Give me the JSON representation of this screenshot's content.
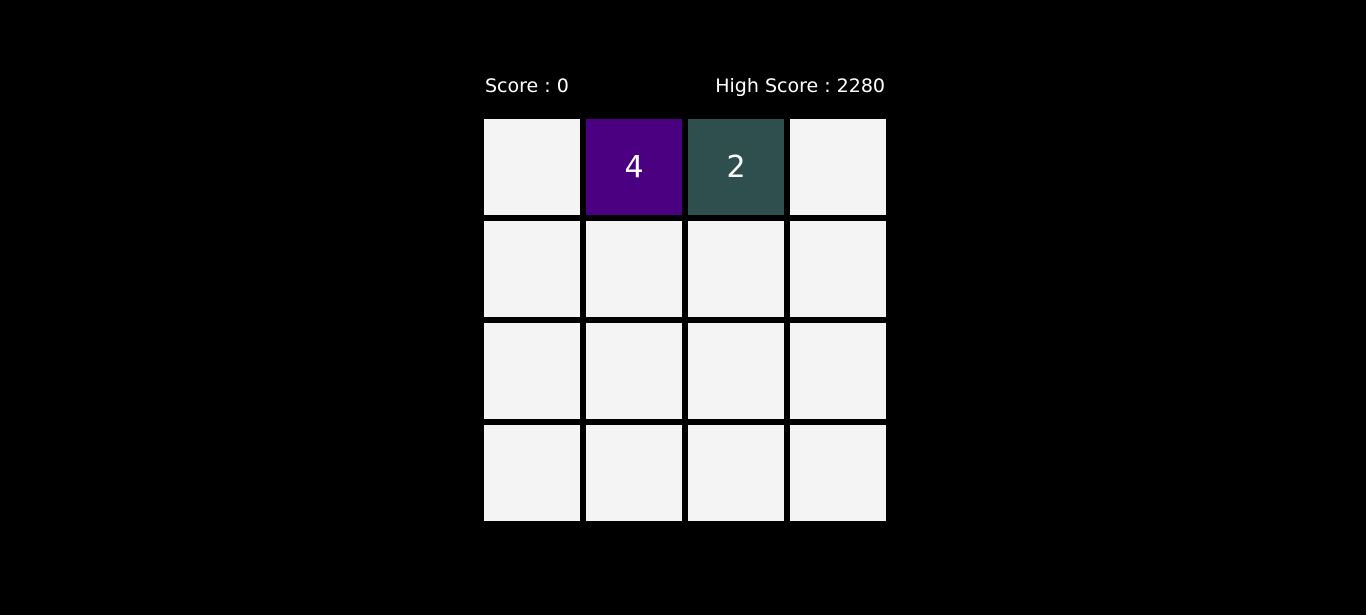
{
  "scores": {
    "score_label": "Score : 0",
    "high_score_label": "High Score : 2280"
  },
  "colors": {
    "background": "#000000",
    "empty_tile": "#f4f4f4",
    "tile_2": "#2f4f4f",
    "tile_4": "#4b0082",
    "text": "#ffffff"
  },
  "board": {
    "rows": [
      [
        "",
        "4",
        "2",
        ""
      ],
      [
        "",
        "",
        "",
        ""
      ],
      [
        "",
        "",
        "",
        ""
      ],
      [
        "",
        "",
        "",
        ""
      ]
    ]
  }
}
